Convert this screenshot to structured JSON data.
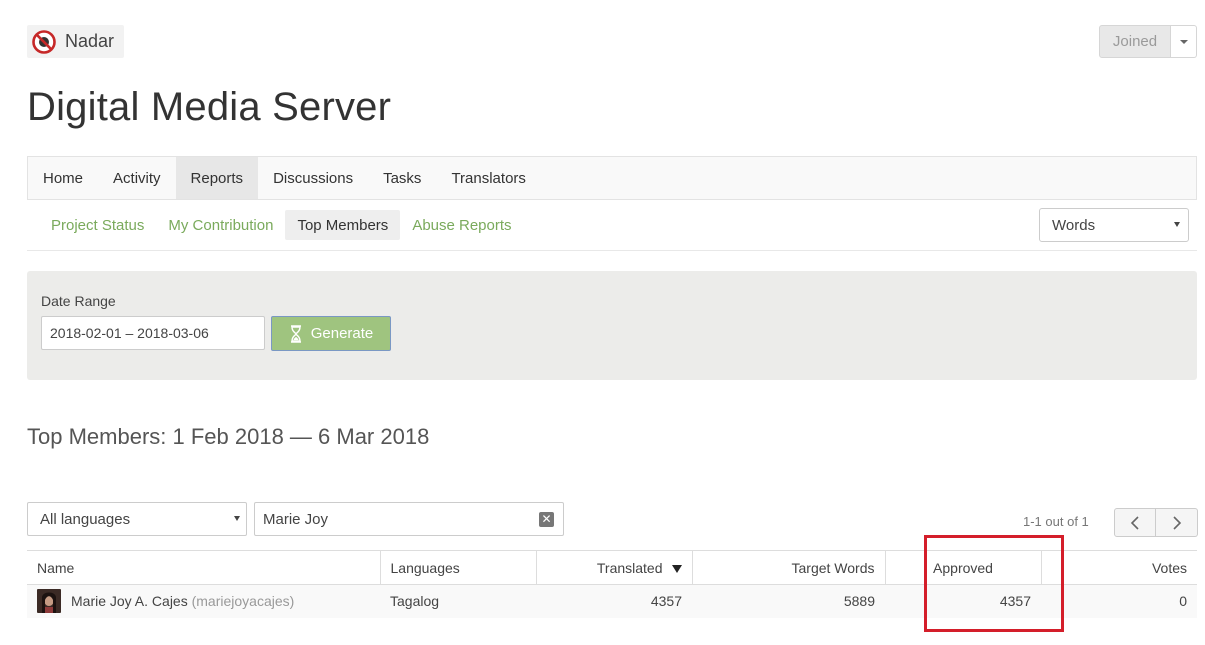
{
  "header": {
    "brand_name": "Nadar",
    "brand_logo_icon": "no-entry-logo-icon",
    "joined_label": "Joined",
    "joined_menu_icon": "chevron-down-icon"
  },
  "project_title": "Digital Media Server",
  "main_nav": {
    "items": [
      {
        "label": "Home"
      },
      {
        "label": "Activity"
      },
      {
        "label": "Reports"
      },
      {
        "label": "Discussions"
      },
      {
        "label": "Tasks"
      },
      {
        "label": "Translators"
      }
    ],
    "active": "Reports"
  },
  "sub_nav": {
    "items": [
      {
        "label": "Project Status"
      },
      {
        "label": "My Contribution"
      },
      {
        "label": "Top Members"
      },
      {
        "label": "Abuse Reports"
      }
    ],
    "active": "Top Members",
    "link_color": "#7aaa5c",
    "metric_select_value": "Words"
  },
  "date_range": {
    "label": "Date Range",
    "value": "2018-02-01 – 2018-03-06",
    "generate_label": "Generate",
    "generate_icon": "hourglass-icon",
    "generate_color": "#9fc47f"
  },
  "report_title": "Top Members: 1 Feb 2018 — 6 Mar 2018",
  "filters": {
    "language_value": "All languages",
    "name_value": "Marie Joy",
    "clear_icon": "clear-icon"
  },
  "pagination": {
    "info": "1-1 out of 1",
    "prev_icon": "chevron-left-icon",
    "next_icon": "chevron-right-icon"
  },
  "table": {
    "columns": {
      "name": "Name",
      "languages": "Languages",
      "translated": "Translated",
      "target_words": "Target Words",
      "approved": "Approved",
      "votes": "Votes"
    },
    "sorted_by": "Translated",
    "rows": [
      {
        "name": "Marie Joy A. Cajes",
        "username": "(mariejoyacajes)",
        "language": "Tagalog",
        "translated": "4357",
        "target_words": "5889",
        "approved": "4357",
        "votes": "0"
      }
    ]
  },
  "annotation": {
    "highlight_color": "#d41e2a",
    "highlighted_column": "Approved"
  }
}
